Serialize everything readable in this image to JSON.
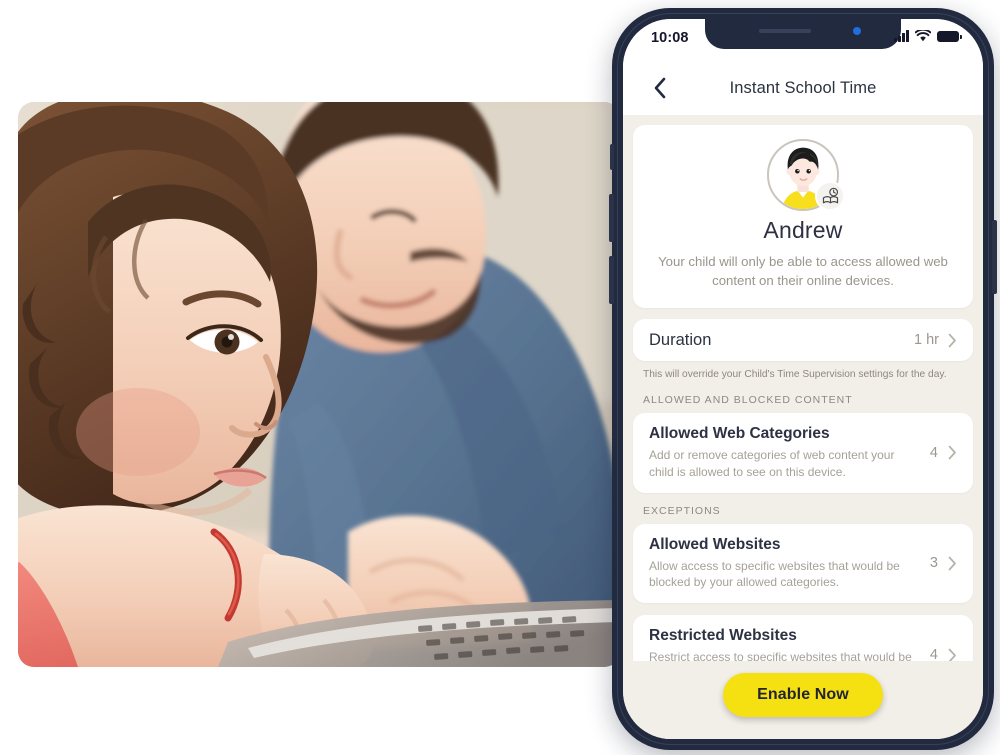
{
  "photo": {
    "alt": "Father and young daughter using a laptop together",
    "colors": {
      "background": "#ddd4c6",
      "shirt_blue": "#5d7898",
      "child_top": "#ef7f75",
      "hair_brown": "#6b4730",
      "skin": "#f0cdb4"
    }
  },
  "phone": {
    "frame_color": "#222a3f",
    "screen_bg": "#f2efe9"
  },
  "status_bar": {
    "time": "10:08",
    "signal_icon": "cellular-signal-icon",
    "wifi_icon": "wifi-icon",
    "battery_icon": "battery-icon"
  },
  "nav": {
    "back_icon": "chevron-left-icon",
    "title": "Instant School Time"
  },
  "profile": {
    "avatar_icon": "child-avatar-icon",
    "badge_icon": "school-time-book-clock-icon",
    "name": "Andrew",
    "description": "Your child will only be able to access allowed web content on their online devices."
  },
  "duration": {
    "label": "Duration",
    "value": "1 hr",
    "chevron_icon": "chevron-right-icon",
    "hint": "This will override your Child's Time Supervision settings for the day."
  },
  "sections": [
    {
      "heading": "ALLOWED AND BLOCKED CONTENT",
      "rows": [
        {
          "title": "Allowed Web Categories",
          "subtitle": "Add or remove categories of web content your child is allowed to see on this device.",
          "count": "4",
          "chevron_icon": "chevron-right-icon"
        }
      ]
    },
    {
      "heading": "EXCEPTIONS",
      "rows": [
        {
          "title": "Allowed Websites",
          "subtitle": "Allow access to specific websites that would be blocked by your allowed categories.",
          "count": "3",
          "chevron_icon": "chevron-right-icon"
        },
        {
          "title": "Restricted Websites",
          "subtitle": "Restrict access to specific websites that would be allowed by your allowed categories.",
          "count": "4",
          "chevron_icon": "chevron-right-icon"
        }
      ]
    }
  ],
  "footer": {
    "enable_label": "Enable Now",
    "accent_color": "#f5e011"
  }
}
